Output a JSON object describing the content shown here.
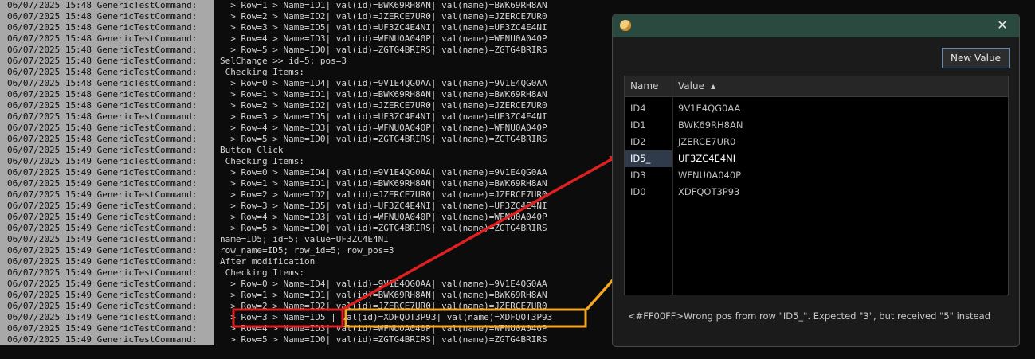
{
  "console": {
    "lines": [
      {
        "prefix": "06/07/2025 15:48 GenericTestCommand:",
        "msg": "  > Row=1 > Name=ID1| val(id)=BWK69RH8AN| val(name)=BWK69RH8AN"
      },
      {
        "prefix": "06/07/2025 15:48 GenericTestCommand:",
        "msg": "  > Row=2 > Name=ID2| val(id)=JZERCE7UR0| val(name)=JZERCE7UR0"
      },
      {
        "prefix": "06/07/2025 15:48 GenericTestCommand:",
        "msg": "  > Row=3 > Name=ID5| val(id)=UF3ZC4E4NI| val(name)=UF3ZC4E4NI"
      },
      {
        "prefix": "06/07/2025 15:48 GenericTestCommand:",
        "msg": "  > Row=4 > Name=ID3| val(id)=WFNU0A040P| val(name)=WFNU0A040P"
      },
      {
        "prefix": "06/07/2025 15:48 GenericTestCommand:",
        "msg": "  > Row=5 > Name=ID0| val(id)=ZGTG4BRIRS| val(name)=ZGTG4BRIRS"
      },
      {
        "prefix": "06/07/2025 15:48 GenericTestCommand:",
        "msg": "SelChange >> id=5; pos=3"
      },
      {
        "prefix": "06/07/2025 15:48 GenericTestCommand:",
        "msg": " Checking Items:"
      },
      {
        "prefix": "06/07/2025 15:48 GenericTestCommand:",
        "msg": "  > Row=0 > Name=ID4| val(id)=9V1E4QG0AA| val(name)=9V1E4QG0AA"
      },
      {
        "prefix": "06/07/2025 15:48 GenericTestCommand:",
        "msg": "  > Row=1 > Name=ID1| val(id)=BWK69RH8AN| val(name)=BWK69RH8AN"
      },
      {
        "prefix": "06/07/2025 15:48 GenericTestCommand:",
        "msg": "  > Row=2 > Name=ID2| val(id)=JZERCE7UR0| val(name)=JZERCE7UR0"
      },
      {
        "prefix": "06/07/2025 15:48 GenericTestCommand:",
        "msg": "  > Row=3 > Name=ID5| val(id)=UF3ZC4E4NI| val(name)=UF3ZC4E4NI"
      },
      {
        "prefix": "06/07/2025 15:48 GenericTestCommand:",
        "msg": "  > Row=4 > Name=ID3| val(id)=WFNU0A040P| val(name)=WFNU0A040P"
      },
      {
        "prefix": "06/07/2025 15:48 GenericTestCommand:",
        "msg": "  > Row=5 > Name=ID0| val(id)=ZGTG4BRIRS| val(name)=ZGTG4BRIRS"
      },
      {
        "prefix": "06/07/2025 15:49 GenericTestCommand:",
        "msg": "Button Click"
      },
      {
        "prefix": "06/07/2025 15:49 GenericTestCommand:",
        "msg": " Checking Items:"
      },
      {
        "prefix": "06/07/2025 15:49 GenericTestCommand:",
        "msg": "  > Row=0 > Name=ID4| val(id)=9V1E4QG0AA| val(name)=9V1E4QG0AA"
      },
      {
        "prefix": "06/07/2025 15:49 GenericTestCommand:",
        "msg": "  > Row=1 > Name=ID1| val(id)=BWK69RH8AN| val(name)=BWK69RH8AN"
      },
      {
        "prefix": "06/07/2025 15:49 GenericTestCommand:",
        "msg": "  > Row=2 > Name=ID2| val(id)=JZERCE7UR0| val(name)=JZERCE7UR0"
      },
      {
        "prefix": "06/07/2025 15:49 GenericTestCommand:",
        "msg": "  > Row=3 > Name=ID5| val(id)=UF3ZC4E4NI| val(name)=UF3ZC4E4NI"
      },
      {
        "prefix": "06/07/2025 15:49 GenericTestCommand:",
        "msg": "  > Row=4 > Name=ID3| val(id)=WFNU0A040P| val(name)=WFNU0A040P"
      },
      {
        "prefix": "06/07/2025 15:49 GenericTestCommand:",
        "msg": "  > Row=5 > Name=ID0| val(id)=ZGTG4BRIRS| val(name)=ZGTG4BRIRS"
      },
      {
        "prefix": "06/07/2025 15:49 GenericTestCommand:",
        "msg": "name=ID5; id=5; value=UF3ZC4E4NI"
      },
      {
        "prefix": "06/07/2025 15:49 GenericTestCommand:",
        "msg": "row_name=ID5; row_id=5; row_pos=3"
      },
      {
        "prefix": "06/07/2025 15:49 GenericTestCommand:",
        "msg": "After modification"
      },
      {
        "prefix": "06/07/2025 15:49 GenericTestCommand:",
        "msg": " Checking Items:"
      },
      {
        "prefix": "06/07/2025 15:49 GenericTestCommand:",
        "msg": "  > Row=0 > Name=ID4| val(id)=9V1E4QG0AA| val(name)=9V1E4QG0AA"
      },
      {
        "prefix": "06/07/2025 15:49 GenericTestCommand:",
        "msg": "  > Row=1 > Name=ID1| val(id)=BWK69RH8AN| val(name)=BWK69RH8AN"
      },
      {
        "prefix": "06/07/2025 15:49 GenericTestCommand:",
        "msg": "  > Row=2 > Name=ID2| val(id)=JZERCE7UR0| val(name)=JZERCE7UR0"
      },
      {
        "prefix": "06/07/2025 15:49 GenericTestCommand:",
        "msg": "  > Row=3 > Name=ID5_| val(id)=XDFQOT3P93| val(name)=XDFQOT3P93"
      },
      {
        "prefix": "06/07/2025 15:49 GenericTestCommand:",
        "msg": "  > Row=4 > Name=ID3| val(id)=WFNU0A040P| val(name)=WFNU0A040P"
      },
      {
        "prefix": "06/07/2025 15:49 GenericTestCommand:",
        "msg": "  > Row=5 > Name=ID0| val(id)=ZGTG4BRIRS| val(name)=ZGTG4BRIRS"
      }
    ]
  },
  "dialog": {
    "app_icon": "app-icon",
    "close_glyph": "✕",
    "new_value_label": "New Value",
    "columns": {
      "name": "Name",
      "value": "Value"
    },
    "sort_glyph": "▲",
    "rows": [
      {
        "name": "ID4",
        "value": "9V1E4QG0AA"
      },
      {
        "name": "ID1",
        "value": "BWK69RH8AN"
      },
      {
        "name": "ID2",
        "value": "JZERCE7UR0"
      },
      {
        "name": "ID5_",
        "value": "UF3ZC4E4NI"
      },
      {
        "name": "ID3",
        "value": "WFNU0A040P"
      },
      {
        "name": "ID0",
        "value": "XDFQOT3P93"
      }
    ],
    "selected_row": 3,
    "status": "<#FF00FF>Wrong pos from row \"ID5_\". Expected \"3\", but received \"5\" instead"
  },
  "colors": {
    "titlebar": "#2a4a3f",
    "annotation_red": "#e02020",
    "annotation_orange": "#f5a623"
  }
}
